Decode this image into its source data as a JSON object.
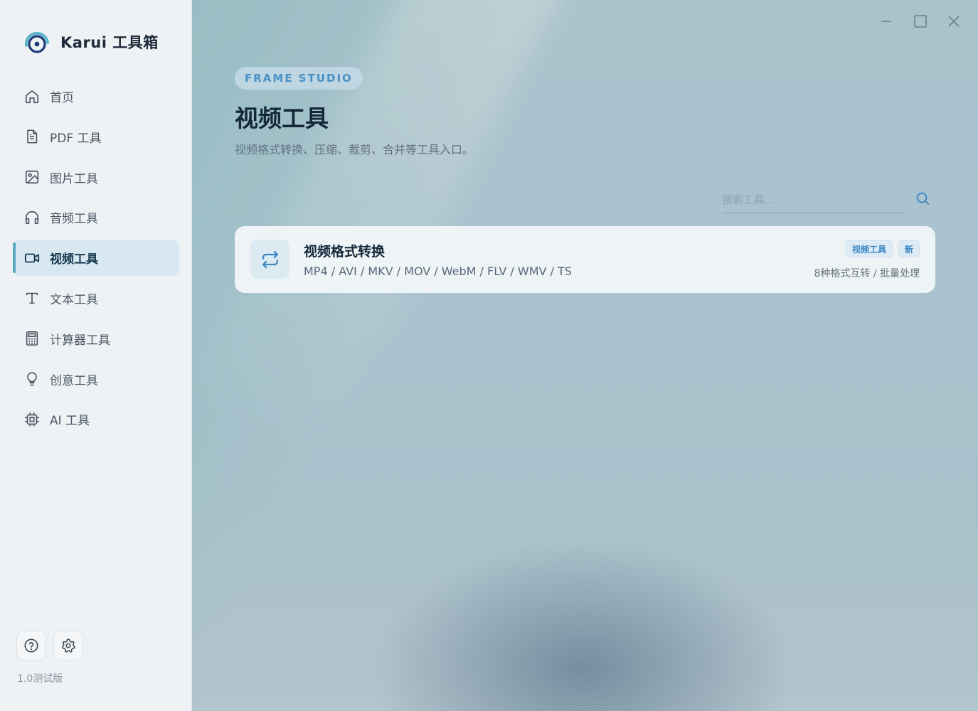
{
  "app": {
    "name": "Karui 工具箱",
    "version": "1.0测试版"
  },
  "sidebar": {
    "items": [
      {
        "label": "首页",
        "icon": "home-icon",
        "active": false
      },
      {
        "label": "PDF 工具",
        "icon": "document-icon",
        "active": false
      },
      {
        "label": "图片工具",
        "icon": "image-icon",
        "active": false
      },
      {
        "label": "音频工具",
        "icon": "headphones-icon",
        "active": false
      },
      {
        "label": "视频工具",
        "icon": "video-camera-icon",
        "active": true
      },
      {
        "label": "文本工具",
        "icon": "text-icon",
        "active": false
      },
      {
        "label": "计算器工具",
        "icon": "calculator-icon",
        "active": false
      },
      {
        "label": "创意工具",
        "icon": "lightbulb-icon",
        "active": false
      },
      {
        "label": "AI 工具",
        "icon": "chip-icon",
        "active": false
      }
    ],
    "bottom_buttons": [
      {
        "icon": "help-icon"
      },
      {
        "icon": "gear-icon"
      }
    ]
  },
  "header": {
    "eyebrow": "FRAME STUDIO",
    "title": "视频工具",
    "subtitle": "视频格式转换、压缩、裁剪、合并等工具入口。"
  },
  "search": {
    "placeholder": "搜索工具..."
  },
  "tools": [
    {
      "title": "视频格式转换",
      "icon": "swap-arrows-icon",
      "formats": "MP4 / AVI / MKV / MOV / WebM / FLV / WMV / TS",
      "tags": [
        "视频工具",
        "新"
      ],
      "meta": "8种格式互转 / 批量处理"
    }
  ],
  "colors": {
    "accent": "#4a90c4",
    "active_bar": "#5aa9c6",
    "title": "#14283a"
  }
}
